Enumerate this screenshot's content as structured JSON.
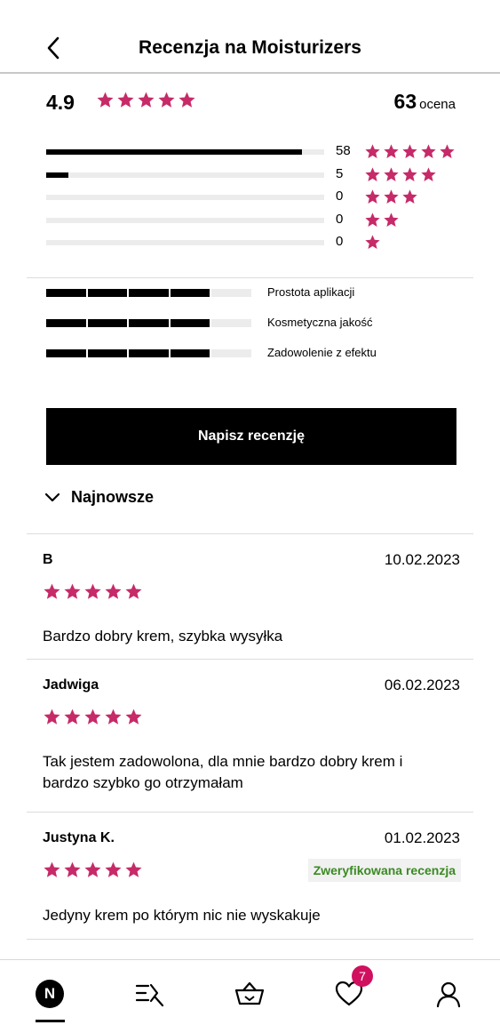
{
  "header": {
    "title": "Recenzja na Moisturizers"
  },
  "summary": {
    "rating": "4.9",
    "stars": 5,
    "total": "63",
    "total_label": "ocena"
  },
  "distribution": [
    {
      "stars": 5,
      "count": "58",
      "fraction": 0.92
    },
    {
      "stars": 4,
      "count": "5",
      "fraction": 0.08
    },
    {
      "stars": 3,
      "count": "0",
      "fraction": 0
    },
    {
      "stars": 2,
      "count": "0",
      "fraction": 0
    },
    {
      "stars": 1,
      "count": "0",
      "fraction": 0
    }
  ],
  "attributes": [
    {
      "label": "Prostota aplikacji",
      "filled_segments": 4,
      "segments": 5
    },
    {
      "label": "Kosmetyczna jakość",
      "filled_segments": 4,
      "segments": 5
    },
    {
      "label": "Zadowolenie z efektu",
      "filled_segments": 4,
      "segments": 5
    }
  ],
  "write_button": "Napisz recenzję",
  "sort": {
    "label": "Najnowsze",
    "icon": "chevron-down-icon"
  },
  "reviews": [
    {
      "author": "B",
      "date": "10.02.2023",
      "stars": 5,
      "text": "Bardzo dobry krem, szybka wysyłka",
      "badge": ""
    },
    {
      "author": "Jadwiga",
      "date": "06.02.2023",
      "stars": 5,
      "text": "Tak jestem zadowolona, dla mnie bardzo dobry krem i bardzo szybko go otrzymałam",
      "badge": ""
    },
    {
      "author": "Justyna K.",
      "date": "01.02.2023",
      "stars": 5,
      "text": "Jedyny krem po którym nic nie wyskakuje",
      "badge": "Zweryfikowana recenzja"
    }
  ],
  "tabbar": {
    "home_logo": "N",
    "favorites_count": "7",
    "icons": [
      "home-logo-icon",
      "catalog-search-icon",
      "basket-icon",
      "heart-icon",
      "user-icon"
    ]
  },
  "colors": {
    "star": "#c62a68",
    "verified": "#3a8a22",
    "badge": "#d0105f",
    "button": "#000000"
  }
}
